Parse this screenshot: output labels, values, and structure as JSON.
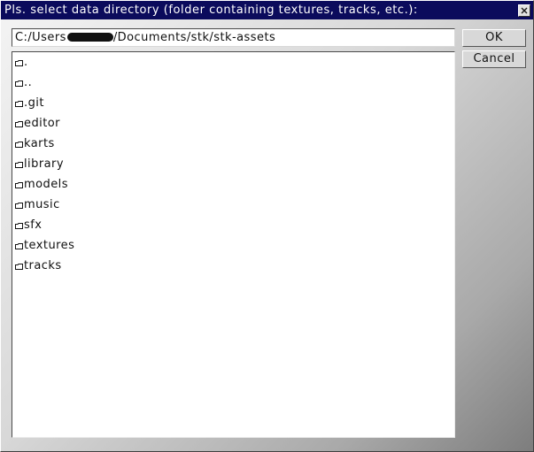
{
  "dialog": {
    "title": "Pls. select data directory (folder containing textures, tracks, etc.):",
    "path_prefix": "C:/Users",
    "path_suffix": "/Documents/stk/stk-assets",
    "items": [
      ".",
      "..",
      ".git",
      "editor",
      "karts",
      "library",
      "models",
      "music",
      "sfx",
      "textures",
      "tracks"
    ]
  },
  "buttons": {
    "ok": "OK",
    "cancel": "Cancel"
  },
  "icons": {
    "close": "close-icon",
    "folder": "folder-icon"
  },
  "colors": {
    "title_bar": "#0b0b5c",
    "title_text": "#ffffff",
    "list_background": "#ffffff"
  }
}
